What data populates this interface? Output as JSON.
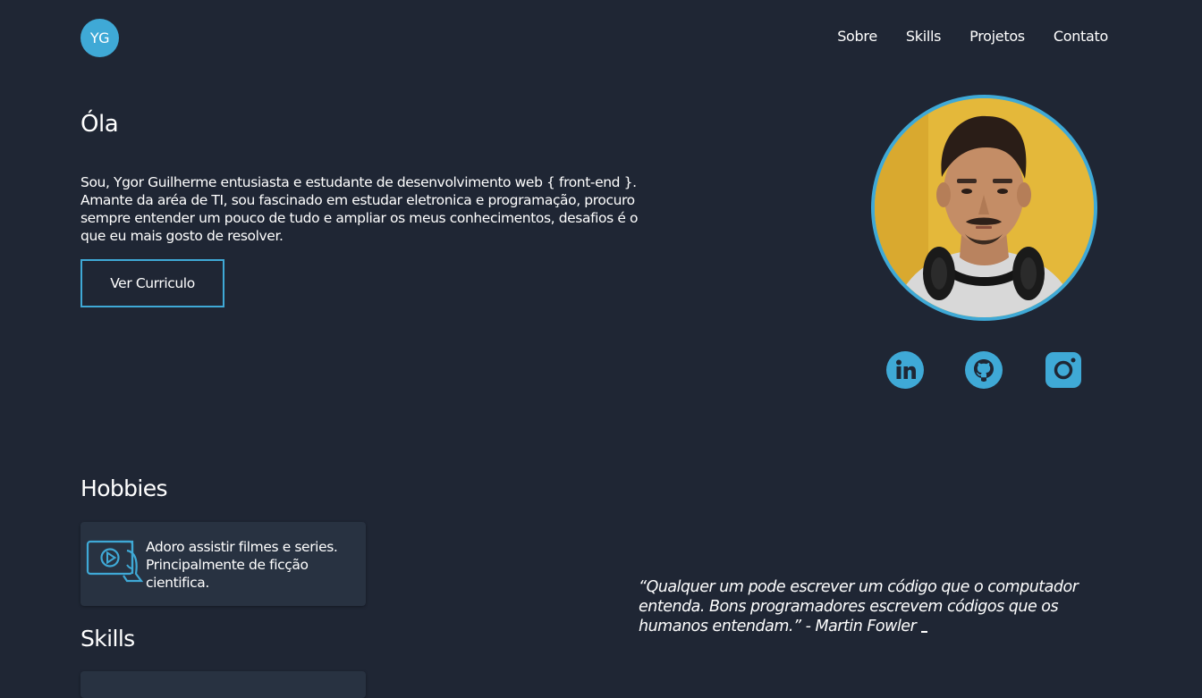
{
  "header": {
    "logo_initials": "YG",
    "nav": [
      "Sobre",
      "Skills",
      "Projetos",
      "Contato"
    ]
  },
  "hero": {
    "greeting": "Óla",
    "intro": "Sou, Ygor Guilherme entusiasta e estudante de desenvolvimento web { front-end }. Amante da aréa de TI, sou fascinado em estudar eletronica e programação, procuro sempre entender um pouco de tudo e ampliar os meus conhecimentos, desafios é o que eu mais gosto de resolver.",
    "cv_button": "Ver Curriculo"
  },
  "social": {
    "icons": [
      "linkedin-icon",
      "github-icon",
      "instagram-icon"
    ]
  },
  "hobbies": {
    "title": "Hobbies",
    "items": [
      {
        "icon": "video-player-icon",
        "text": "Adoro assistir filmes e series. Principalmente de ficção cientifica."
      }
    ]
  },
  "skills": {
    "title": "Skills"
  },
  "quote": {
    "text": "“Qualquer um pode escrever um código que o computador entenda. Bons programadores escrevem códigos que os humanos entendam.” - Martin Fowler"
  },
  "colors": {
    "background": "#1f2634",
    "accent": "#3fa9d6",
    "card": "#283241",
    "text": "#ffffff"
  }
}
